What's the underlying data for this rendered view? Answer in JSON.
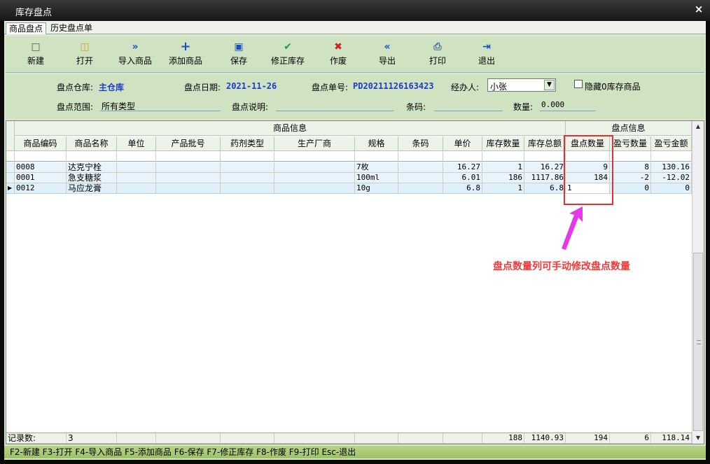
{
  "window": {
    "title": "库存盘点",
    "close_symbol": "×"
  },
  "tabs": [
    {
      "label": "商品盘点",
      "active": true
    },
    {
      "label": "历史盘点单",
      "active": false
    }
  ],
  "toolbar": [
    {
      "label": "新建",
      "icon": "new-file-icon"
    },
    {
      "label": "打开",
      "icon": "open-folder-icon"
    },
    {
      "label": "导入商品",
      "icon": "import-icon"
    },
    {
      "label": "添加商品",
      "icon": "add-icon"
    },
    {
      "label": "保存",
      "icon": "save-icon"
    },
    {
      "label": "修正库存",
      "icon": "check-icon"
    },
    {
      "label": "作废",
      "icon": "cancel-icon"
    },
    {
      "label": "导出",
      "icon": "export-icon"
    },
    {
      "label": "打印",
      "icon": "printer-icon"
    },
    {
      "label": "退出",
      "icon": "exit-icon"
    }
  ],
  "form": {
    "warehouse_label": "盘点仓库:",
    "warehouse_value": "主仓库",
    "date_label": "盘点日期:",
    "date_value": "2021-11-26",
    "order_label": "盘点单号:",
    "order_value": "PD20211126163423",
    "handler_label": "经办人:",
    "handler_value": "小张",
    "hide_zero_label": "隐藏0库存商品",
    "range_label": "盘点范围:",
    "range_value": "所有类型",
    "note_label": "盘点说明:",
    "note_value": "",
    "barcode_label": "条码:",
    "barcode_value": "",
    "qty_label": "数量:",
    "qty_value": "0.000"
  },
  "grid": {
    "group_headers": {
      "product_info": "商品信息",
      "check_info": "盘点信息"
    },
    "columns": [
      "商品编码",
      "商品名称",
      "单位",
      "产品批号",
      "药剂类型",
      "生产厂商",
      "规格",
      "条码",
      "单价",
      "库存数量",
      "库存总额",
      "盘点数量",
      "盈亏数量",
      "盈亏金额"
    ],
    "rows": [
      [
        "0008",
        "达克宁栓",
        "",
        "",
        "",
        "",
        "7枚",
        "",
        "16.27",
        "1",
        "16.27",
        "9",
        "8",
        "130.16"
      ],
      [
        "0001",
        "急支糖浆",
        "",
        "",
        "",
        "",
        "100ml",
        "",
        "6.01",
        "186",
        "1117.86",
        "184",
        "-2",
        "-12.02"
      ],
      [
        "0012",
        "马应龙膏",
        "",
        "",
        "",
        "",
        "10g",
        "",
        "6.8",
        "1",
        "6.8",
        "1",
        "0",
        "0"
      ]
    ],
    "current_row": 2,
    "footer": {
      "record_label": "记录数:",
      "record_count": "3",
      "stock_qty_total": "188",
      "stock_amount_total": "1140.93",
      "check_qty_total": "194",
      "diff_qty_total": "6",
      "diff_amount_total": "118.14"
    }
  },
  "annotation": {
    "text": "盘点数量列可手动修改盘点数量",
    "color": "#ef3a3a"
  },
  "statusbar": {
    "text": "F2-新建 F3-打开 F4-导入商品 F5-添加商品 F6-保存 F7-修正库存 F8-作废 F9-打印 Esc-退出"
  }
}
